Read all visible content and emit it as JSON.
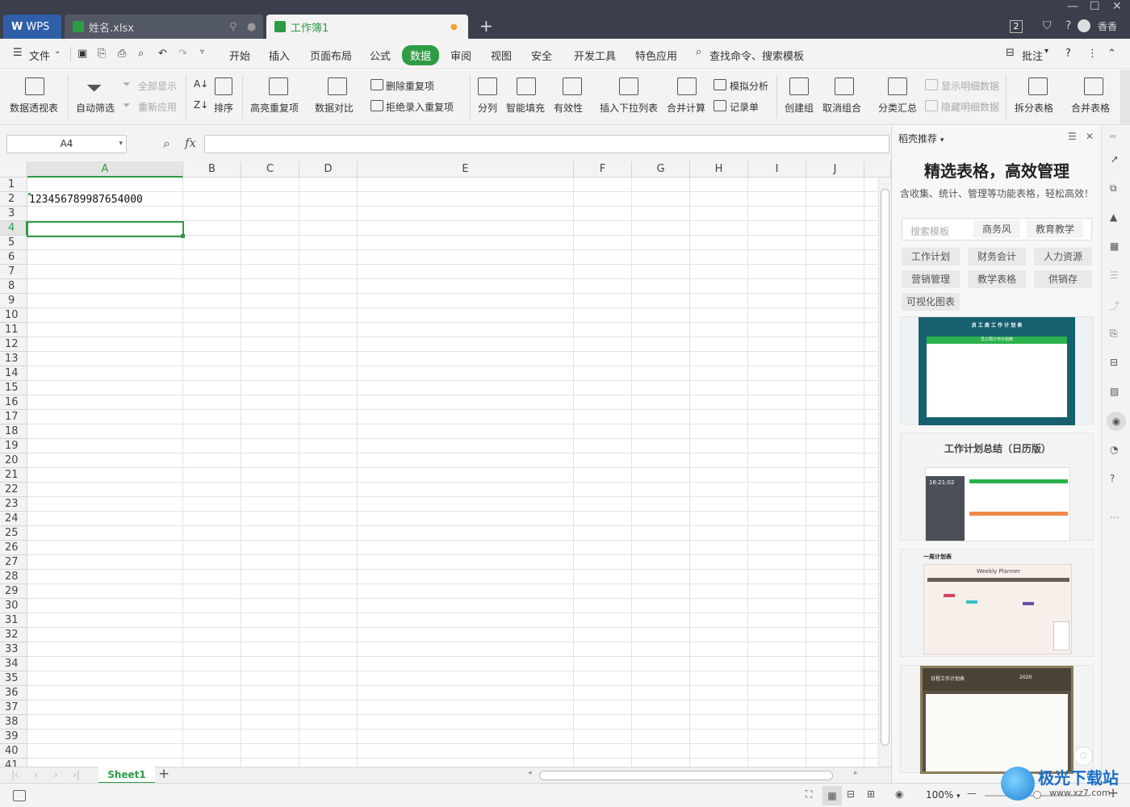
{
  "titlebar": {
    "wps_tab": "WPS",
    "file_tab": "姓名.xlsx",
    "active_tab": "工作簿1",
    "new_tab_glyph": "+",
    "badge": "2",
    "user": "香香"
  },
  "menubar": {
    "file": "文件",
    "items": [
      "开始",
      "插入",
      "页面布局",
      "公式",
      "数据",
      "审阅",
      "视图",
      "安全",
      "开发工具",
      "特色应用"
    ],
    "active": "数据",
    "search": "查找命令、搜索模板",
    "comment": "批注"
  },
  "ribbon": {
    "pivot": "数据透视表",
    "autofilter": "自动筛选",
    "show_all": "全部显示",
    "reapply": "重新应用",
    "sort": "排序",
    "highlight_dup": "高亮重复项",
    "compare": "数据对比",
    "remove_dup": "删除重复项",
    "reject_dup": "拒绝录入重复项",
    "split": "分列",
    "smart_fill": "智能填充",
    "validity": "有效性",
    "insert_dropdown": "插入下拉列表",
    "consolidate": "合并计算",
    "what_if": "模拟分析",
    "record_form": "记录单",
    "group": "创建组",
    "ungroup": "取消组合",
    "subtotal": "分类汇总",
    "show_detail": "显示明细数据",
    "hide_detail": "隐藏明细数据",
    "split_table": "拆分表格",
    "merge_table": "合并表格"
  },
  "formula": {
    "name_box": "A4",
    "fx": "fx",
    "value": ""
  },
  "grid": {
    "columns": [
      "A",
      "B",
      "C",
      "D",
      "E",
      "F",
      "G",
      "H",
      "I",
      "J"
    ],
    "rows": [
      "1",
      "2",
      "3",
      "4",
      "5",
      "6",
      "7",
      "8",
      "9",
      "10",
      "11",
      "12",
      "13",
      "14",
      "15",
      "16",
      "17",
      "18",
      "19",
      "20",
      "21",
      "22",
      "23",
      "24",
      "25",
      "26",
      "27",
      "28",
      "29",
      "30",
      "31",
      "32",
      "33",
      "34",
      "35",
      "36",
      "37",
      "38",
      "39",
      "40",
      "41"
    ],
    "cell_a2": "123456789987654000",
    "selected_cell": "A4"
  },
  "sheets": {
    "active": "Sheet1",
    "add": "+"
  },
  "panel": {
    "title": "稻壳推荐",
    "headline": "精选表格，高效管理",
    "subtitle": "含收集、统计、管理等功能表格，轻松高效！",
    "search_placeholder": "搜索模板",
    "search_tags": [
      "商务风",
      "教育教学"
    ],
    "categories": [
      "工作计划",
      "财务会计",
      "人力资源",
      "营销管理",
      "教学表格",
      "供销存",
      "可视化图表"
    ],
    "template1_title": "员 工 周 工 作 计 划 表",
    "template1_sub": "员工周工作计划表",
    "template2_title": "工作计划总结（日历版）",
    "template2_time": "16:21:02",
    "template3_title": "一周计划表",
    "template3_sub": "Weekly  Planner",
    "template4_title": "日程工作计划表",
    "template4_year": "2020"
  },
  "statusbar": {
    "zoom": "100%",
    "zoom_out": "—",
    "zoom_in": "+"
  },
  "watermark": {
    "text": "极光下载站",
    "url": "www.xz7.com"
  },
  "colors": {
    "accent": "#2e9c44",
    "titlebar": "#3b3f4c",
    "wps_tab": "#2f5fa8"
  }
}
